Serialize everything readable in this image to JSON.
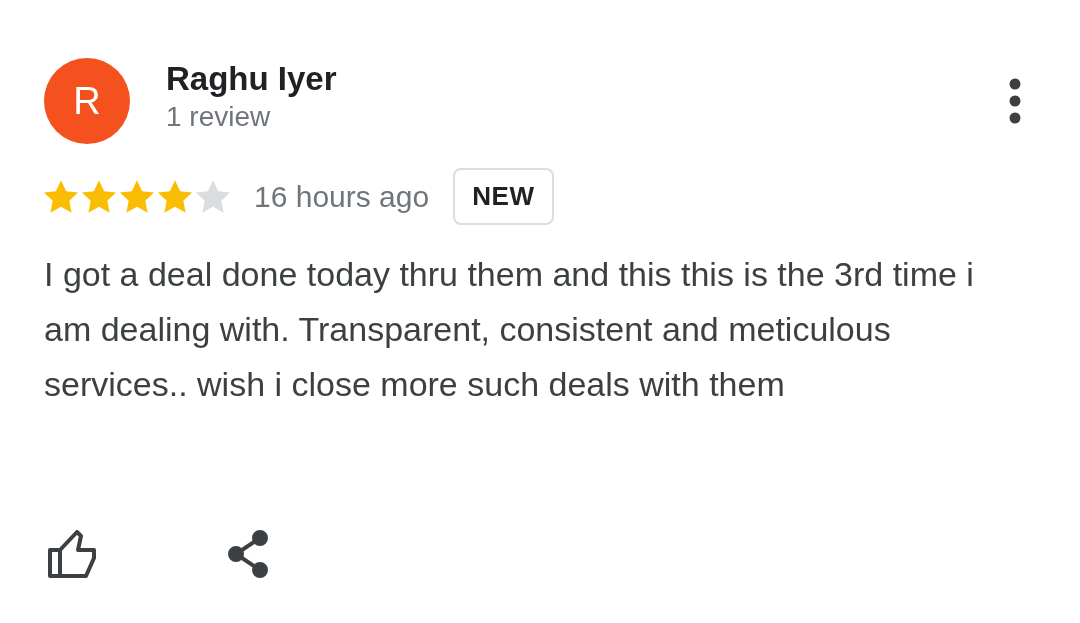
{
  "review": {
    "avatar_letter": "R",
    "author": "Raghu Iyer",
    "review_count": "1 review",
    "stars": 4,
    "time": "16 hours ago",
    "badge": "NEW",
    "text": "I got a deal done today thru them and this this is the 3rd time i am dealing with. Transparent, consistent and meticulous services.. wish i close more such deals with them"
  }
}
